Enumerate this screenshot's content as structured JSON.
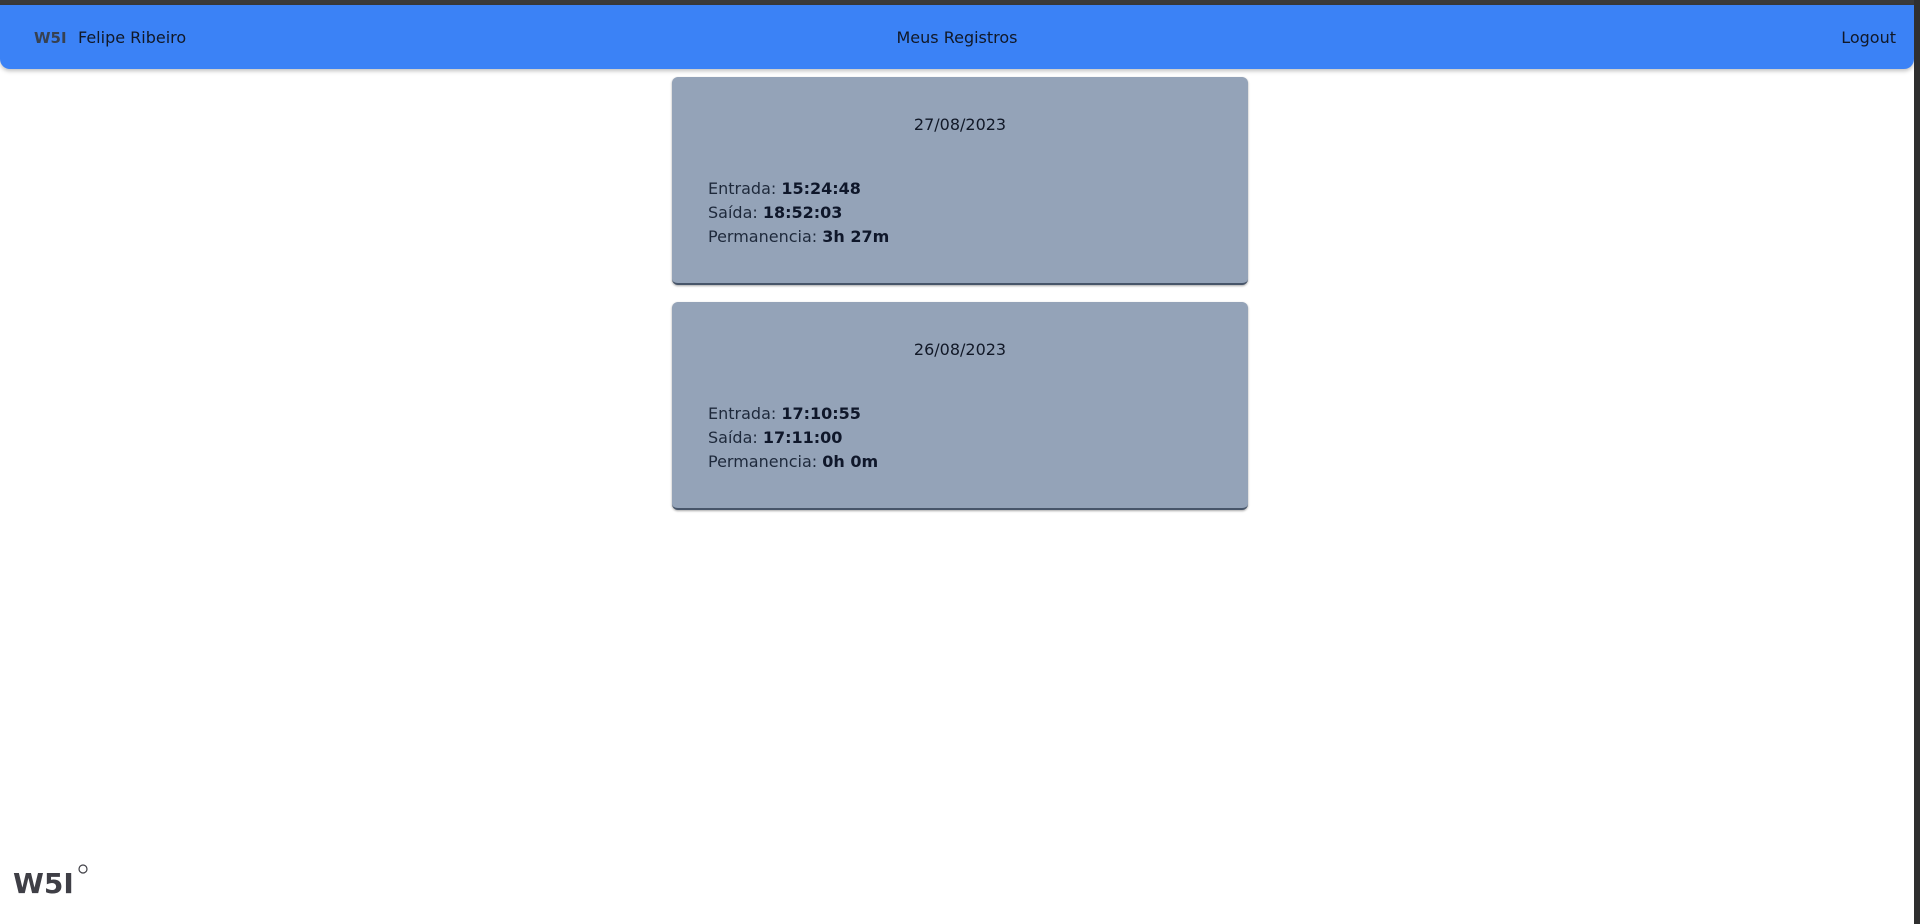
{
  "navbar": {
    "logo_icon": "w5i-logo",
    "user_name": "Felipe Ribeiro",
    "title": "Meus Registros",
    "logout_label": "Logout",
    "background": "#3b82f6"
  },
  "records": [
    {
      "date": "27/08/2023",
      "entrada_label": "Entrada: ",
      "entrada_value": "15:24:48",
      "saida_label": "Saída: ",
      "saida_value": "18:52:03",
      "permanencia_label": "Permanencia: ",
      "permanencia_value": "3h 27m"
    },
    {
      "date": "26/08/2023",
      "entrada_label": "Entrada: ",
      "entrada_value": "17:10:55",
      "saida_label": "Saída: ",
      "saida_value": "17:11:00",
      "permanencia_label": "Permanencia: ",
      "permanencia_value": "0h 0m"
    }
  ],
  "footer": {
    "logo_icon": "w5i-logo"
  },
  "colors": {
    "card_background": "#94a3b8",
    "accent": "#3b82f6"
  }
}
